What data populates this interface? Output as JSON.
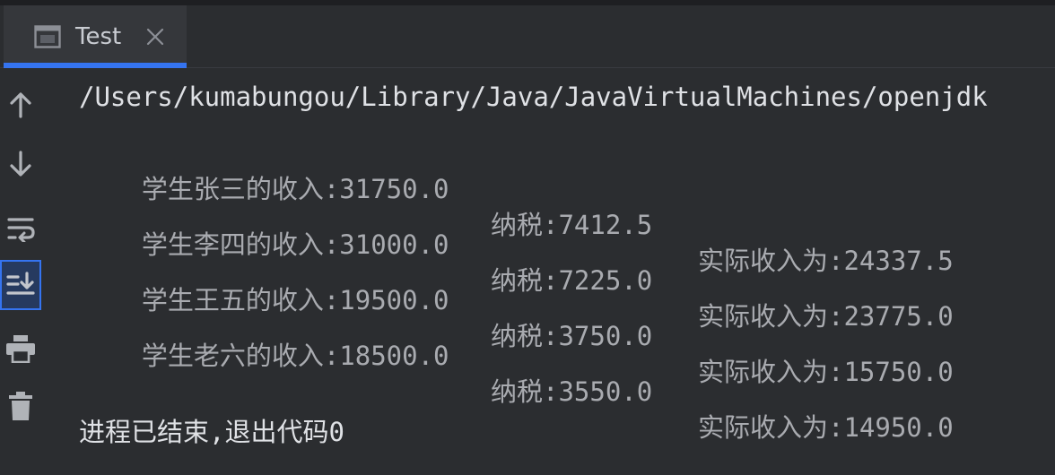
{
  "tab": {
    "label": "Test",
    "icon": "console-window-icon",
    "close_icon": "close-icon"
  },
  "toolbar": {
    "items": [
      {
        "name": "up-arrow-icon",
        "label": "Up"
      },
      {
        "name": "down-arrow-icon",
        "label": "Down"
      },
      {
        "name": "soft-wrap-icon",
        "label": "Soft wrap"
      },
      {
        "name": "scroll-to-end-icon",
        "label": "Scroll to end",
        "active": true
      },
      {
        "name": "print-icon",
        "label": "Print"
      },
      {
        "name": "trash-icon",
        "label": "Clear"
      }
    ]
  },
  "console": {
    "command": "/Users/kumabungou/Library/Java/JavaVirtualMachines/openjdk",
    "rows": [
      {
        "income": "学生张三的收入:31750.0",
        "tax": "纳税:7412.5",
        "net": "实际收入为:24337.5"
      },
      {
        "income": "学生李四的收入:31000.0",
        "tax": "纳税:7225.0",
        "net": "实际收入为:23775.0"
      },
      {
        "income": "学生王五的收入:19500.0",
        "tax": "纳税:3750.0",
        "net": "实际收入为:15750.0"
      },
      {
        "income": "学生老六的收入:18500.0",
        "tax": "纳税:3550.0",
        "net": "实际收入为:14950.0"
      }
    ],
    "exit_message": "进程已结束,退出代码0"
  },
  "colors": {
    "background": "#2b2d30",
    "accent": "#3574f0",
    "text": "#bcbec4"
  }
}
